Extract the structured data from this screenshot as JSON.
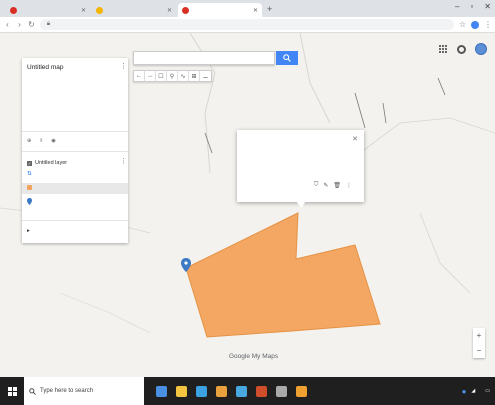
{
  "browser": {
    "tabs": [
      {
        "title": "",
        "color": "#d93025"
      },
      {
        "title": "",
        "color": "#f4b400"
      },
      {
        "title": "",
        "color": "#d93025",
        "active": true
      }
    ],
    "new_tab": "+",
    "url": ""
  },
  "map": {
    "search_placeholder": "",
    "toolbar": [
      "←",
      "→",
      "☐",
      "⚲",
      "∿",
      "⊞",
      "⚊"
    ],
    "place_labels": [
      "",
      "",
      "",
      "",
      "",
      "",
      "",
      "",
      "",
      "",
      "",
      "",
      "",
      ""
    ],
    "polygon_color": "#f3a35b",
    "polygon_stroke": "#e58e3e",
    "logo_text": "Google My Maps",
    "attribution": ""
  },
  "panel": {
    "title": "Untitled map",
    "subtitle": "",
    "description": "",
    "actions": {
      "add_layer": "",
      "share": "",
      "preview": ""
    },
    "layer": {
      "name": "Untitled layer",
      "style_link": "",
      "features": [
        {
          "label": "",
          "swatch": "#f3a35b",
          "selected": true
        },
        {
          "label": "",
          "swatch": "#3d7ac5",
          "selected": false
        }
      ]
    },
    "base_map": ""
  },
  "info_window": {
    "title": "",
    "line1": "",
    "line2": "",
    "line3": ""
  },
  "taskbar": {
    "search_text": "Type here to search",
    "icon_colors": [
      "#4a90e2",
      "#f5c542",
      "#3ba1e0",
      "#e8a13c",
      "#4aa8e0",
      "#d04d2b",
      "#aaaaaa",
      "#f0a030"
    ],
    "time": "",
    "date": ""
  }
}
